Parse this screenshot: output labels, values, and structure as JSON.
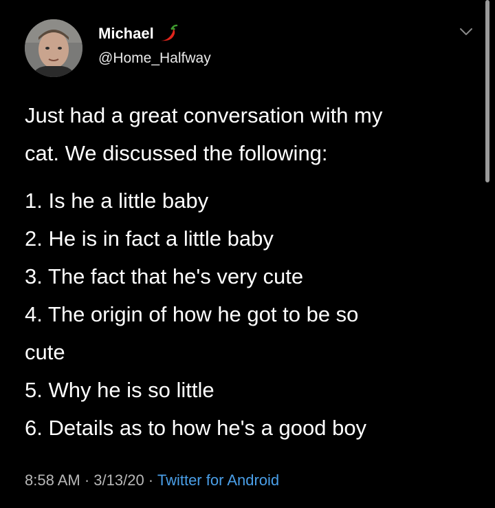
{
  "author": {
    "display_name": "Michael",
    "handle": "@Home_Halfway",
    "avatar_icon": "person-avatar",
    "name_emoji_icon": "hot-pepper-icon"
  },
  "tweet": {
    "intro_lines": [
      "Just had a great conversation with my",
      "cat. We discussed the following:"
    ],
    "list_lines": [
      "1. Is he a little baby",
      "2. He is in fact a little baby",
      "3. The fact that he's very cute",
      "4. The origin of how he got to be so",
      "cute",
      "5. Why he is so little",
      "6. Details as to how he's a good boy"
    ]
  },
  "meta": {
    "time": "8:58 AM",
    "separator": " · ",
    "date": "3/13/20",
    "source": "Twitter for Android"
  },
  "colors": {
    "background": "#000000",
    "text": "#ffffff",
    "meta_text": "#b8b8b8",
    "link": "#4a9fe8"
  }
}
